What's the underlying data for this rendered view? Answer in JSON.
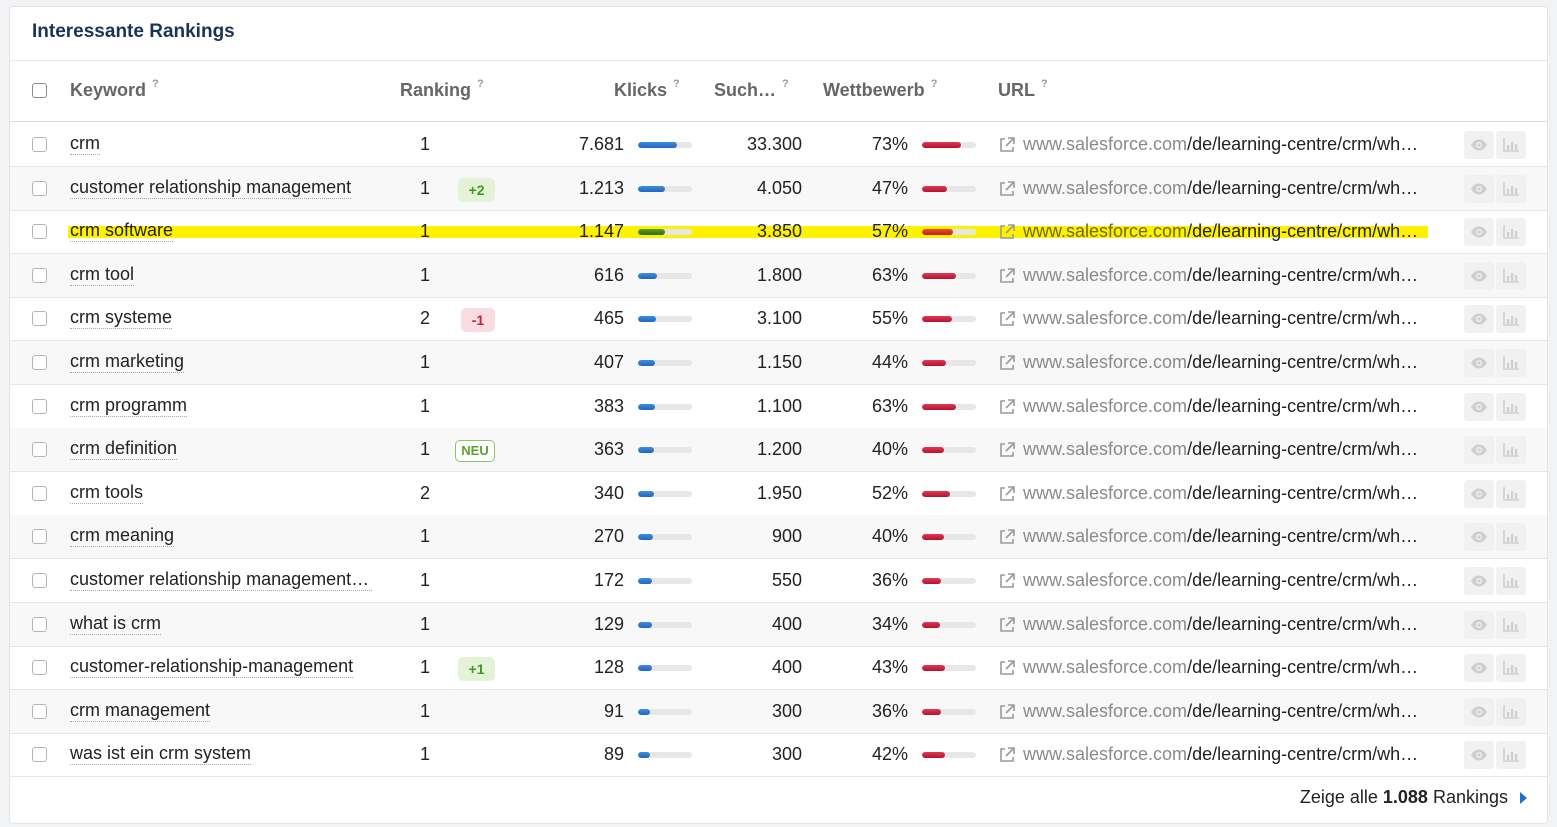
{
  "title": "Interessante Rankings",
  "columns": {
    "keyword": "Keyword",
    "ranking": "Ranking",
    "klicks": "Klicks",
    "such": "Such…",
    "wettbewerb": "Wettbewerb",
    "url": "URL",
    "help": "?"
  },
  "rows": [
    {
      "keyword": "crm",
      "rank": "1",
      "badge": "",
      "badge_type": "",
      "clicks": "7.681",
      "clicks_ratio": 0.72,
      "volume": "33.300",
      "competition": "73%",
      "competition_ratio": 0.73,
      "host": "www.salesforce.com",
      "path": "/de/learning-centre/crm/what-is-crm/",
      "highlighted": false
    },
    {
      "keyword": "customer relationship management",
      "rank": "1",
      "badge": "+2",
      "badge_type": "up",
      "clicks": "1.213",
      "clicks_ratio": 0.5,
      "volume": "4.050",
      "competition": "47%",
      "competition_ratio": 0.47,
      "host": "www.salesforce.com",
      "path": "/de/learning-centre/crm/what-is-crm/",
      "highlighted": false
    },
    {
      "keyword": "crm software",
      "rank": "1",
      "badge": "",
      "badge_type": "",
      "clicks": "1.147",
      "clicks_ratio": 0.5,
      "volume": "3.850",
      "competition": "57%",
      "competition_ratio": 0.57,
      "host": "www.salesforce.com",
      "path": "/de/learning-centre/crm/what-is-crm/",
      "highlighted": true
    },
    {
      "keyword": "crm tool",
      "rank": "1",
      "badge": "",
      "badge_type": "",
      "clicks": "616",
      "clicks_ratio": 0.36,
      "volume": "1.800",
      "competition": "63%",
      "competition_ratio": 0.63,
      "host": "www.salesforce.com",
      "path": "/de/learning-centre/crm/what-is-crm/",
      "highlighted": false
    },
    {
      "keyword": "crm systeme",
      "rank": "2",
      "badge": "-1",
      "badge_type": "down",
      "clicks": "465",
      "clicks_ratio": 0.33,
      "volume": "3.100",
      "competition": "55%",
      "competition_ratio": 0.55,
      "host": "www.salesforce.com",
      "path": "/de/learning-centre/crm/what-is-crm/",
      "highlighted": false
    },
    {
      "keyword": "crm marketing",
      "rank": "1",
      "badge": "",
      "badge_type": "",
      "clicks": "407",
      "clicks_ratio": 0.32,
      "volume": "1.150",
      "competition": "44%",
      "competition_ratio": 0.44,
      "host": "www.salesforce.com",
      "path": "/de/learning-centre/crm/what-is-crm/",
      "highlighted": false
    },
    {
      "keyword": "crm programm",
      "rank": "1",
      "badge": "",
      "badge_type": "",
      "clicks": "383",
      "clicks_ratio": 0.31,
      "volume": "1.100",
      "competition": "63%",
      "competition_ratio": 0.63,
      "host": "www.salesforce.com",
      "path": "/de/learning-centre/crm/what-is-crm/",
      "highlighted": false
    },
    {
      "keyword": "crm definition",
      "rank": "1",
      "badge": "NEU",
      "badge_type": "new",
      "clicks": "363",
      "clicks_ratio": 0.3,
      "volume": "1.200",
      "competition": "40%",
      "competition_ratio": 0.4,
      "host": "www.salesforce.com",
      "path": "/de/learning-centre/crm/what-is-crm/",
      "highlighted": false
    },
    {
      "keyword": "crm tools",
      "rank": "2",
      "badge": "",
      "badge_type": "",
      "clicks": "340",
      "clicks_ratio": 0.3,
      "volume": "1.950",
      "competition": "52%",
      "competition_ratio": 0.52,
      "host": "www.salesforce.com",
      "path": "/de/learning-centre/crm/what-is-crm/",
      "highlighted": false
    },
    {
      "keyword": "crm meaning",
      "rank": "1",
      "badge": "",
      "badge_type": "",
      "clicks": "270",
      "clicks_ratio": 0.28,
      "volume": "900",
      "competition": "40%",
      "competition_ratio": 0.4,
      "host": "www.salesforce.com",
      "path": "/de/learning-centre/crm/what-is-crm/",
      "highlighted": false
    },
    {
      "keyword": "customer relationship management definition",
      "rank": "1",
      "badge": "",
      "badge_type": "",
      "clicks": "172",
      "clicks_ratio": 0.26,
      "volume": "550",
      "competition": "36%",
      "competition_ratio": 0.36,
      "host": "www.salesforce.com",
      "path": "/de/learning-centre/crm/what-is-crm/",
      "highlighted": false
    },
    {
      "keyword": "what is crm",
      "rank": "1",
      "badge": "",
      "badge_type": "",
      "clicks": "129",
      "clicks_ratio": 0.25,
      "volume": "400",
      "competition": "34%",
      "competition_ratio": 0.34,
      "host": "www.salesforce.com",
      "path": "/de/learning-centre/crm/what-is-crm/",
      "highlighted": false
    },
    {
      "keyword": "customer-relationship-management",
      "rank": "1",
      "badge": "+1",
      "badge_type": "up",
      "clicks": "128",
      "clicks_ratio": 0.25,
      "volume": "400",
      "competition": "43%",
      "competition_ratio": 0.43,
      "host": "www.salesforce.com",
      "path": "/de/learning-centre/crm/what-is-crm/",
      "highlighted": false
    },
    {
      "keyword": "crm management",
      "rank": "1",
      "badge": "",
      "badge_type": "",
      "clicks": "91",
      "clicks_ratio": 0.22,
      "volume": "300",
      "competition": "36%",
      "competition_ratio": 0.36,
      "host": "www.salesforce.com",
      "path": "/de/learning-centre/crm/what-is-crm/",
      "highlighted": false
    },
    {
      "keyword": "was ist ein crm system",
      "rank": "1",
      "badge": "",
      "badge_type": "",
      "clicks": "89",
      "clicks_ratio": 0.22,
      "volume": "300",
      "competition": "42%",
      "competition_ratio": 0.42,
      "host": "www.salesforce.com",
      "path": "/de/learning-centre/crm/what-is-crm/",
      "highlighted": false
    }
  ],
  "footer": {
    "prefix": "Zeige alle",
    "count": "1.088",
    "suffix": "Rankings"
  },
  "colors": {
    "title": "#1a3456",
    "clicks_bar": "#2f7bd6",
    "competition_bar": "#c8203d",
    "highlight": "#fff200",
    "link_arrow": "#1f6fd1"
  },
  "icons": {
    "external": "external-link-icon",
    "eye": "eye-icon",
    "chart": "bar-chart-icon",
    "footer_arrow": "caret-right-icon"
  }
}
